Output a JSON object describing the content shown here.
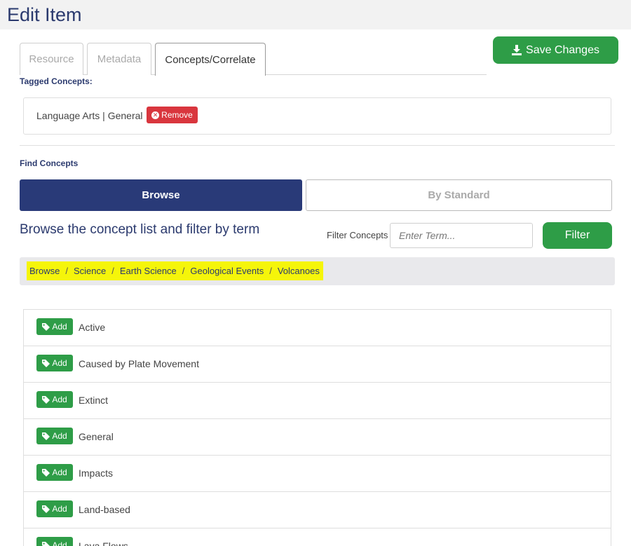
{
  "header": {
    "title": "Edit Item"
  },
  "tabs": [
    {
      "label": "Resource"
    },
    {
      "label": "Metadata"
    },
    {
      "label": "Concepts/Correlate"
    }
  ],
  "save_button": {
    "label": "Save Changes"
  },
  "tagged": {
    "label": "Tagged Concepts:",
    "items": [
      {
        "text": "Language Arts | General",
        "remove_label": "Remove"
      }
    ]
  },
  "find": {
    "label": "Find Concepts",
    "browse_label": "Browse",
    "standard_label": "By Standard"
  },
  "browse": {
    "heading": "Browse the concept list and filter by term",
    "filter_label": "Filter Concepts",
    "filter_placeholder": "Enter Term...",
    "filter_button": "Filter"
  },
  "breadcrumb": [
    "Browse",
    "Science",
    "Earth Science",
    "Geological Events",
    "Volcanoes"
  ],
  "concepts": {
    "add_label": "Add",
    "items": [
      "Active",
      "Caused by Plate Movement",
      "Extinct",
      "General",
      "Impacts",
      "Land-based",
      "Lava Flows"
    ]
  },
  "colors": {
    "primary_navy": "#293a78",
    "success_green": "#2e9d47",
    "danger_red": "#d9363e",
    "highlight_yellow": "#f5f50a"
  }
}
